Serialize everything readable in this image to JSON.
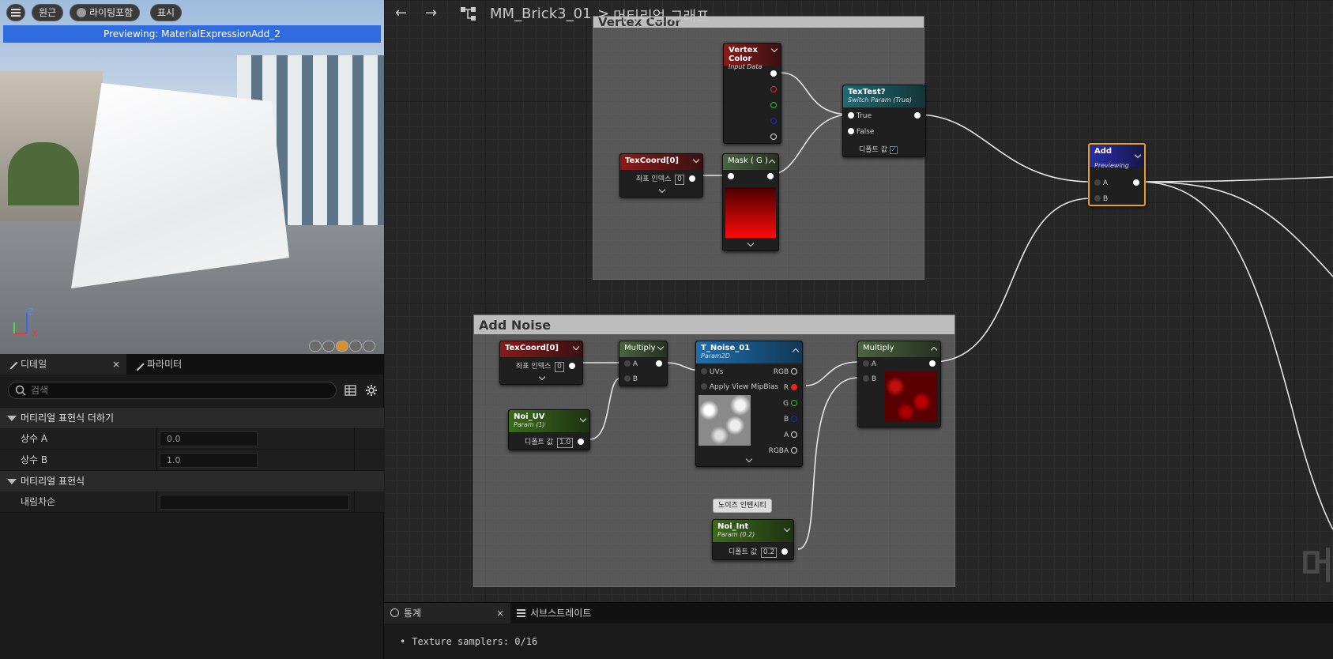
{
  "viewport": {
    "buttons": [
      {
        "label": ""
      },
      {
        "label": "원근"
      },
      {
        "label": "라이팅포함"
      },
      {
        "label": "표시"
      }
    ],
    "preview_text": "Previewing: MaterialExpressionAdd_2",
    "axis_x": "X",
    "axis_z": "Z"
  },
  "details": {
    "tabs": [
      {
        "label": "디테일",
        "close": "×"
      },
      {
        "label": "파라미터"
      }
    ],
    "search_placeholder": "검색",
    "sections": [
      {
        "title": "머티리얼 표현식 더하기",
        "props": [
          {
            "name": "상수 A",
            "value": "0.0"
          },
          {
            "name": "상수 B",
            "value": "1.0"
          }
        ]
      },
      {
        "title": "머티리얼 표현식",
        "props": [
          {
            "name": "내림차순",
            "value": ""
          }
        ]
      }
    ]
  },
  "graph": {
    "breadcrumb": {
      "asset": "MM_Brick3_01",
      "separator": ">",
      "page": "머티리얼 그래프"
    },
    "comments": {
      "vertex": "Vertex Color",
      "noise": "Add Noise"
    },
    "nodes": {
      "vertex_color": {
        "title": "Vertex Color",
        "sub": "Input Data"
      },
      "texcoord1": {
        "title": "TexCoord[0]",
        "pin": "좌표 인덱스",
        "val": "0"
      },
      "mask": {
        "title": "Mask ( G )"
      },
      "textest": {
        "title": "TexTest?",
        "sub": "Switch Param (True)",
        "true": "True",
        "false": "False",
        "default": "디폴트 값"
      },
      "add": {
        "title": "Add",
        "sub": "Previewing",
        "a": "A",
        "b": "B"
      },
      "texcoord2": {
        "title": "TexCoord[0]",
        "pin": "좌표 인덱스",
        "val": "0"
      },
      "multiply1": {
        "title": "Multiply",
        "a": "A",
        "b": "B"
      },
      "noi_uv": {
        "title": "Noi_UV",
        "sub": "Param (1)",
        "pin": "디폴트 값",
        "val": "1.0"
      },
      "t_noise": {
        "title": "T_Noise_01",
        "sub": "Param2D",
        "uvs": "UVs",
        "mip": "Apply View MipBias",
        "rgb": "RGB",
        "r": "R",
        "g": "G",
        "b": "B",
        "a": "A",
        "rgba": "RGBA"
      },
      "multiply2": {
        "title": "Multiply",
        "a": "A",
        "b": "B"
      },
      "noi_int": {
        "title": "Noi_Int",
        "sub": "Param (0.2)",
        "pin": "디폴트 값",
        "val": "0.2",
        "tooltip": "노이즈 인텐시티"
      }
    },
    "watermark": "머"
  },
  "stats": {
    "tabs": [
      {
        "label": "통계",
        "close": "×"
      },
      {
        "label": "서브스트레이트"
      }
    ],
    "lines": [
      "Texture samplers: 0/16"
    ]
  },
  "colors": {
    "accent": "#2f6ce0",
    "selection": "#e8a020"
  }
}
